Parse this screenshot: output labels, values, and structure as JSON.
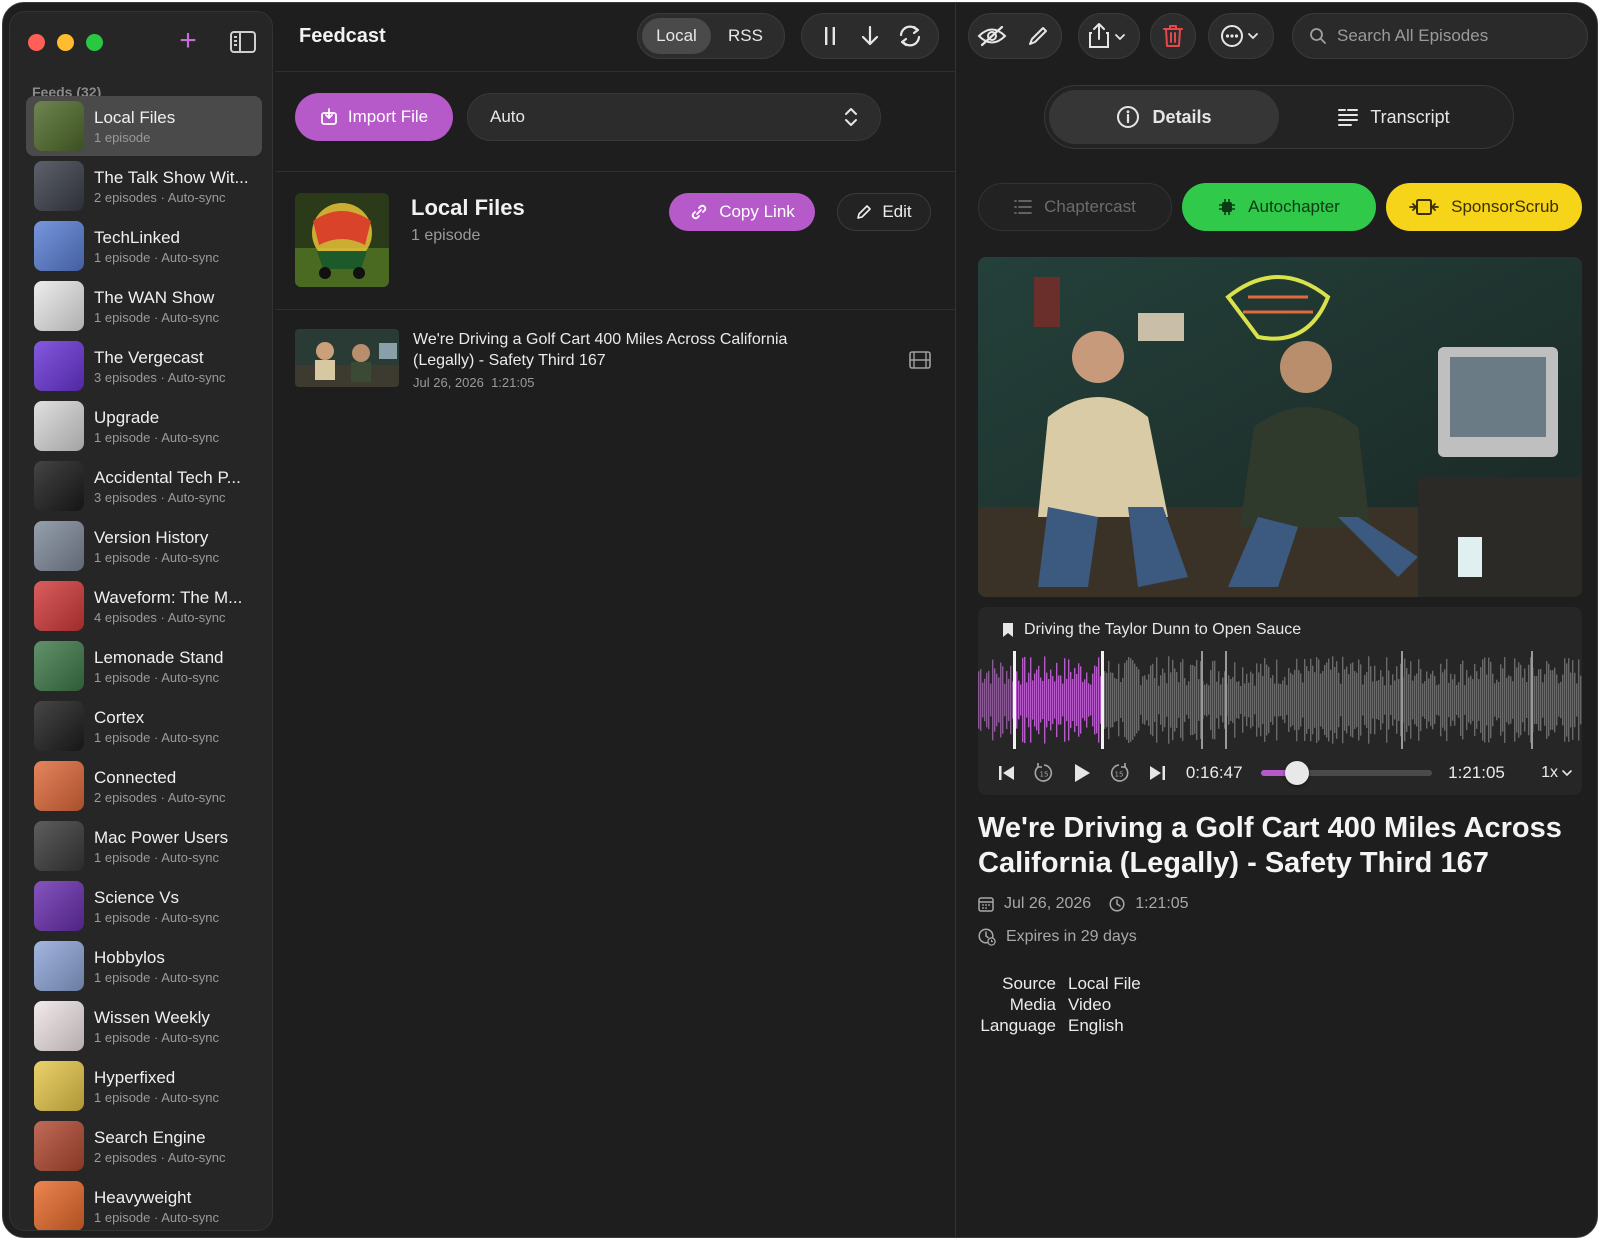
{
  "app": {
    "title": "Feedcast"
  },
  "sidebar": {
    "section_label": "Feeds (32)",
    "feeds": [
      {
        "name": "Local Files",
        "sub": "1 episode",
        "color": "#4f6b2a",
        "active": true
      },
      {
        "name": "The Talk Show Wit...",
        "sub": "2 episodes · Auto-sync",
        "color": "#3b3f4a",
        "active": false
      },
      {
        "name": "TechLinked",
        "sub": "1 episode · Auto-sync",
        "color": "#5a7fd6",
        "active": false
      },
      {
        "name": "The WAN Show",
        "sub": "1 episode · Auto-sync",
        "color": "#e9e9e9",
        "active": false
      },
      {
        "name": "The Vergecast",
        "sub": "3 episodes · Auto-sync",
        "color": "#6a35d8",
        "active": false
      },
      {
        "name": "Upgrade",
        "sub": "1 episode · Auto-sync",
        "color": "#d9d9d9",
        "active": false
      },
      {
        "name": "Accidental Tech P...",
        "sub": "3 episodes · Auto-sync",
        "color": "#1b1b1b",
        "active": false
      },
      {
        "name": "Version History",
        "sub": "1 episode · Auto-sync",
        "color": "#7f8a9a",
        "active": false
      },
      {
        "name": "Waveform: The M...",
        "sub": "4 episodes · Auto-sync",
        "color": "#d33a3a",
        "active": false
      },
      {
        "name": "Lemonade Stand",
        "sub": "1 episode · Auto-sync",
        "color": "#3f7a4a",
        "active": false
      },
      {
        "name": "Cortex",
        "sub": "1 episode · Auto-sync",
        "color": "#1e1e1e",
        "active": false
      },
      {
        "name": "Connected",
        "sub": "2 episodes · Auto-sync",
        "color": "#e06a3a",
        "active": false
      },
      {
        "name": "Mac Power Users",
        "sub": "1 episode · Auto-sync",
        "color": "#3a3a3a",
        "active": false
      },
      {
        "name": "Science Vs",
        "sub": "1 episode · Auto-sync",
        "color": "#6a2fb0",
        "active": false
      },
      {
        "name": "Hobbylos",
        "sub": "1 episode · Auto-sync",
        "color": "#8fa6d9",
        "active": false
      },
      {
        "name": "Wissen Weekly",
        "sub": "1 episode · Auto-sync",
        "color": "#f0e6e6",
        "active": false
      },
      {
        "name": "Hyperfixed",
        "sub": "1 episode · Auto-sync",
        "color": "#e8c84a",
        "active": false
      },
      {
        "name": "Search Engine",
        "sub": "2 episodes · Auto-sync",
        "color": "#b24a32",
        "active": false
      },
      {
        "name": "Heavyweight",
        "sub": "1 episode · Auto-sync",
        "color": "#e86a2a",
        "active": false
      }
    ]
  },
  "toolbar": {
    "local_label": "Local",
    "rss_label": "RSS",
    "search_placeholder": "Search All Episodes"
  },
  "middle": {
    "import_label": "Import File",
    "select_value": "Auto",
    "feed_title": "Local Files",
    "feed_sub": "1 episode",
    "copy_link_label": "Copy Link",
    "edit_label": "Edit",
    "episodes": [
      {
        "title": "We're Driving a Golf Cart 400 Miles Across California (Legally) - Safety Third 167",
        "date": "Jul 26, 2026",
        "duration": "1:21:05"
      }
    ]
  },
  "detail": {
    "tab_details": "Details",
    "tab_transcript": "Transcript",
    "chaptercast_label": "Chaptercast",
    "autochapter_label": "Autochapter",
    "sponsorscrub_label": "SponsorScrub",
    "chapter_name": "Driving the Taylor Dunn to Open Sauce",
    "current_time": "0:16:47",
    "total_time": "1:21:05",
    "progress_fraction": 0.207,
    "speed": "1x",
    "title": "We're Driving a Golf Cart 400 Miles Across California (Legally) - Safety Third 167",
    "date": "Jul 26, 2026",
    "duration": "1:21:05",
    "expires": "Expires in 29 days",
    "info": [
      {
        "key": "Source",
        "value": "Local File"
      },
      {
        "key": "Media",
        "value": "Video"
      },
      {
        "key": "Language",
        "value": "English"
      }
    ]
  },
  "colors": {
    "accent": "#b659c9",
    "autochapter": "#30c94a",
    "sponsorscrub": "#f6d41a",
    "trash": "#e5484d"
  }
}
